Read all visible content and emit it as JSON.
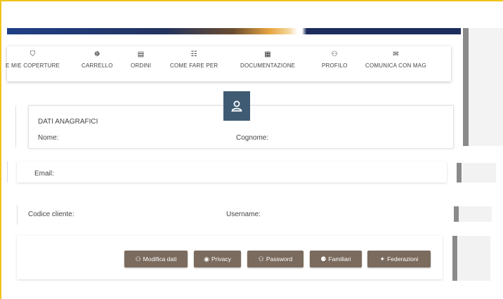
{
  "nav": {
    "items": [
      {
        "label": "E MIE COPERTURE",
        "icon": "shield-icon",
        "glyph": "⛉"
      },
      {
        "label": "CARRELLO",
        "icon": "cart-icon",
        "glyph": "☸"
      },
      {
        "label": "ORDINI",
        "icon": "orders-icon",
        "glyph": "▤"
      },
      {
        "label": "COME FARE PER",
        "icon": "book-icon",
        "glyph": "☷"
      },
      {
        "label": "DOCUMENTAZIONE",
        "icon": "document-icon",
        "glyph": "▦"
      },
      {
        "label": "PROFILO",
        "icon": "user-key-icon",
        "glyph": "⚇"
      },
      {
        "label": "COMUNICA CON MAG",
        "icon": "chat-icon",
        "glyph": "✉"
      }
    ]
  },
  "profile": {
    "section_title": "DATI ANAGRAFICI",
    "nome_label": "Nome:",
    "cognome_label": "Cognome:",
    "email_label": "Email:",
    "codice_label": "Codice cliente:",
    "username_label": "Username:"
  },
  "buttons": [
    {
      "label": "Modifica dati",
      "icon": "user-edit-icon",
      "glyph": "⚇"
    },
    {
      "label": "Privacy",
      "icon": "eye-icon",
      "glyph": "◉"
    },
    {
      "label": "Password",
      "icon": "user-key-icon",
      "glyph": "⚇"
    },
    {
      "label": "Familiari",
      "icon": "family-icon",
      "glyph": "⚈"
    },
    {
      "label": "Federazioni",
      "icon": "federation-icon",
      "glyph": "✦"
    }
  ],
  "colors": {
    "accent_border": "#f0c419",
    "avatar_bg": "#3f5b73",
    "button_bg": "#7b6b5e"
  }
}
